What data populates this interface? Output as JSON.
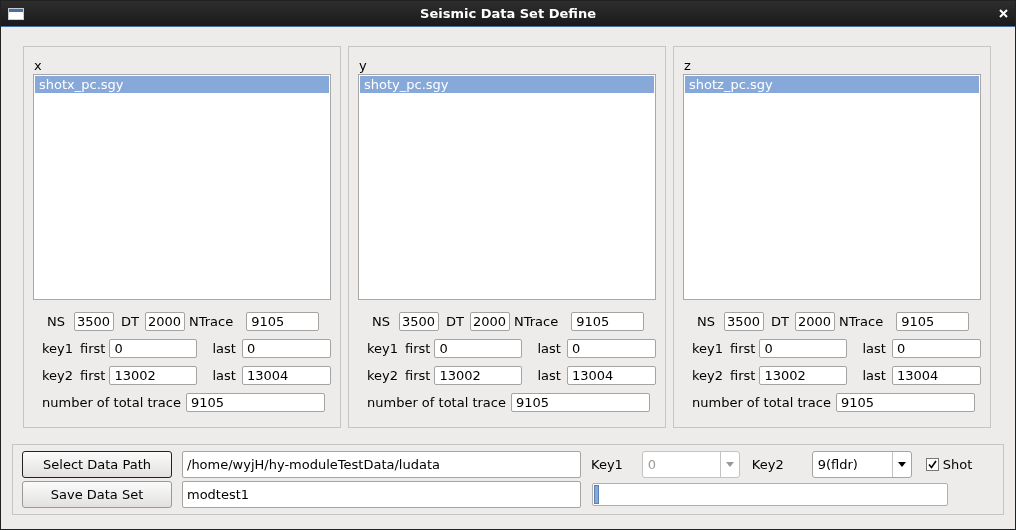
{
  "window": {
    "title": "Seismic Data Set Define"
  },
  "panels": [
    {
      "label": "x",
      "files": [
        {
          "name": "shotx_pc.sgy",
          "selected": true
        }
      ],
      "ns_label": "NS",
      "ns": "3500",
      "dt_label": "DT",
      "dt": "2000",
      "ntrace_label": "NTrace",
      "ntrace": "9105",
      "key1_label": "key1",
      "key1_first_label": "first",
      "key1_first": "0",
      "key1_last_label": "last",
      "key1_last": "0",
      "key2_label": "key2",
      "key2_first_label": "first",
      "key2_first": "13002",
      "key2_last_label": "last",
      "key2_last": "13004",
      "total_label": "number of total trace",
      "total": "9105"
    },
    {
      "label": "y",
      "files": [
        {
          "name": "shoty_pc.sgy",
          "selected": true
        }
      ],
      "ns_label": "NS",
      "ns": "3500",
      "dt_label": "DT",
      "dt": "2000",
      "ntrace_label": "NTrace",
      "ntrace": "9105",
      "key1_label": "key1",
      "key1_first_label": "first",
      "key1_first": "0",
      "key1_last_label": "last",
      "key1_last": "0",
      "key2_label": "key2",
      "key2_first_label": "first",
      "key2_first": "13002",
      "key2_last_label": "last",
      "key2_last": "13004",
      "total_label": "number of total trace",
      "total": "9105"
    },
    {
      "label": "z",
      "files": [
        {
          "name": "shotz_pc.sgy",
          "selected": true
        }
      ],
      "ns_label": "NS",
      "ns": "3500",
      "dt_label": "DT",
      "dt": "2000",
      "ntrace_label": "NTrace",
      "ntrace": "9105",
      "key1_label": "key1",
      "key1_first_label": "first",
      "key1_first": "0",
      "key1_last_label": "last",
      "key1_last": "0",
      "key2_label": "key2",
      "key2_first_label": "first",
      "key2_first": "13002",
      "key2_last_label": "last",
      "key2_last": "13004",
      "total_label": "number of total trace",
      "total": "9105"
    }
  ],
  "bottom": {
    "select_button": "Select Data Path",
    "save_button": "Save Data Set",
    "path": "/home/wyjH/hy-moduleTestData/ludata",
    "name": "modtest1",
    "key1_label": "Key1",
    "key1": {
      "value": "0",
      "disabled": true
    },
    "key2_label": "Key2",
    "key2": {
      "value": "9(fldr)",
      "disabled": false
    },
    "shot": {
      "label": "Shot",
      "checked": true
    },
    "progress": {
      "level": 0.01
    }
  }
}
